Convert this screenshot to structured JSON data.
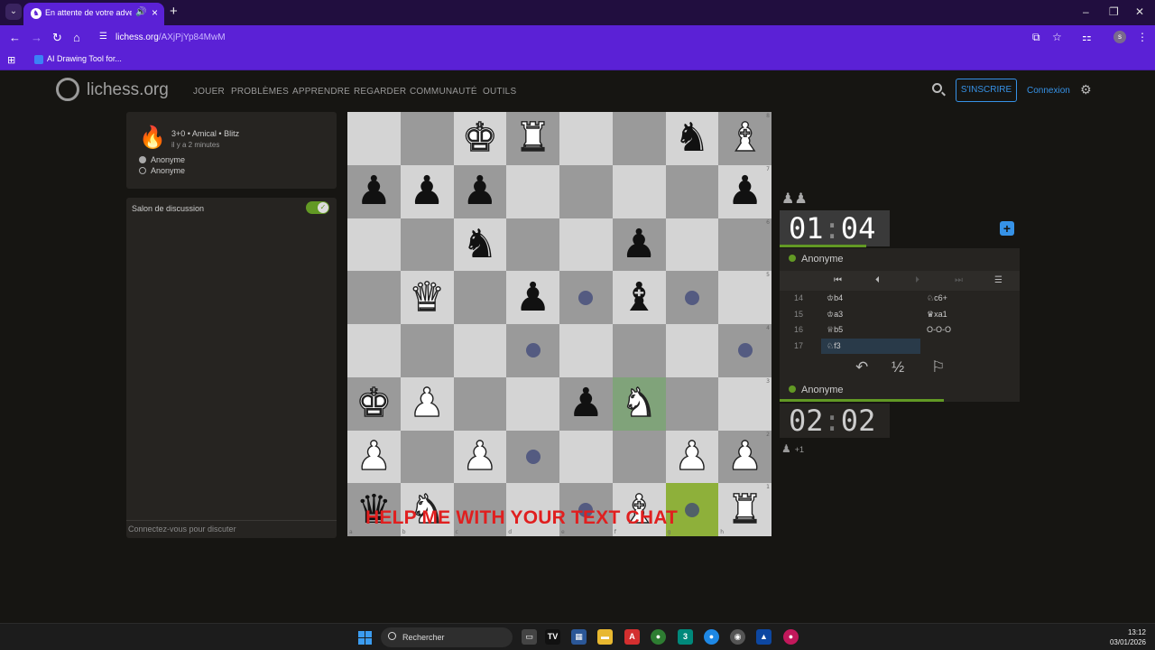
{
  "browser": {
    "tab_title": "En attente de votre adversaire",
    "new_tab": "+",
    "url_host": "lichess.org",
    "url_path": "/AXjPjYp84MwM",
    "bookmark_label": "AI Drawing Tool for..."
  },
  "header": {
    "logo": "lichess.org",
    "nav": [
      "JOUER",
      "PROBLÈMES",
      "APPRENDRE",
      "REGARDER",
      "COMMUNAUTÉ",
      "OUTILS"
    ],
    "signup": "S'INSCRIRE",
    "login": "Connexion"
  },
  "game_info": {
    "setup": "3+0 • Amical • Blitz",
    "time_ago": "il y a 2 minutes",
    "players": [
      "Anonyme",
      "Anonyme"
    ]
  },
  "chat": {
    "title": "Salon de discussion",
    "placeholder": "Connectez-vous pour discuter",
    "enabled": true
  },
  "board": {
    "files": [
      "a",
      "b",
      "c",
      "d",
      "e",
      "f",
      "g",
      "h"
    ],
    "ranks": [
      "8",
      "7",
      "6",
      "5",
      "4",
      "3",
      "2",
      "1"
    ],
    "rows": [
      [
        null,
        null,
        {
          "c": "w",
          "g": "♚"
        },
        {
          "c": "w",
          "g": "♜"
        },
        null,
        null,
        {
          "c": "b",
          "g": "♞"
        },
        {
          "c": "w",
          "g": "♝"
        }
      ],
      [
        {
          "c": "b",
          "g": "♟"
        },
        {
          "c": "b",
          "g": "♟"
        },
        {
          "c": "b",
          "g": "♟"
        },
        null,
        null,
        null,
        null,
        {
          "c": "b",
          "g": "♟"
        }
      ],
      [
        null,
        null,
        {
          "c": "b",
          "g": "♞"
        },
        null,
        null,
        {
          "c": "b",
          "g": "♟"
        },
        null,
        null
      ],
      [
        null,
        {
          "c": "w",
          "g": "♛"
        },
        null,
        {
          "c": "b",
          "g": "♟"
        },
        "dot",
        {
          "c": "b",
          "g": "♝"
        },
        "dot",
        null
      ],
      [
        null,
        null,
        null,
        "dot",
        null,
        null,
        null,
        "dot"
      ],
      [
        {
          "c": "w",
          "g": "♚"
        },
        {
          "c": "w",
          "g": "♟"
        },
        null,
        null,
        {
          "c": "b",
          "g": "♟"
        },
        {
          "c": "w",
          "g": "♞",
          "hl": true
        },
        null,
        null
      ],
      [
        {
          "c": "w",
          "g": "♟"
        },
        null,
        {
          "c": "w",
          "g": "♟"
        },
        "dot",
        null,
        null,
        {
          "c": "w",
          "g": "♟"
        },
        {
          "c": "w",
          "g": "♟"
        }
      ],
      [
        {
          "c": "b",
          "g": "♛"
        },
        {
          "c": "w",
          "g": "♞"
        },
        null,
        null,
        "dot",
        {
          "c": "w",
          "g": "♝"
        },
        "hl2",
        {
          "c": "w",
          "g": "♜"
        }
      ]
    ],
    "overlay_text": "HELP ME WITH YOUR TEXT CHAT"
  },
  "clocks": {
    "top_min": "01",
    "top_sec": "04",
    "bottom_min": "02",
    "bottom_sec": "02",
    "separator": ":"
  },
  "players": {
    "top": "Anonyme",
    "bottom": "Anonyme",
    "material_top": "♟♟",
    "material_bottom": "♟",
    "material_bottom_count": "+1"
  },
  "moves": [
    {
      "num": "14",
      "white": "♔b4",
      "black": "♘c6+"
    },
    {
      "num": "15",
      "white": "♔a3",
      "black": "♛xa1"
    },
    {
      "num": "16",
      "white": "♕b5",
      "black": "O-O-O"
    },
    {
      "num": "17",
      "white": "♘f3",
      "black": ""
    }
  ],
  "taskbar": {
    "search": "Rechercher",
    "time": "13:12",
    "date": "03/01/2026"
  },
  "colors": {
    "accent": "#3692e7",
    "green": "#629924",
    "overlay": "#e01f1f",
    "chrome": "#5b21d6"
  }
}
